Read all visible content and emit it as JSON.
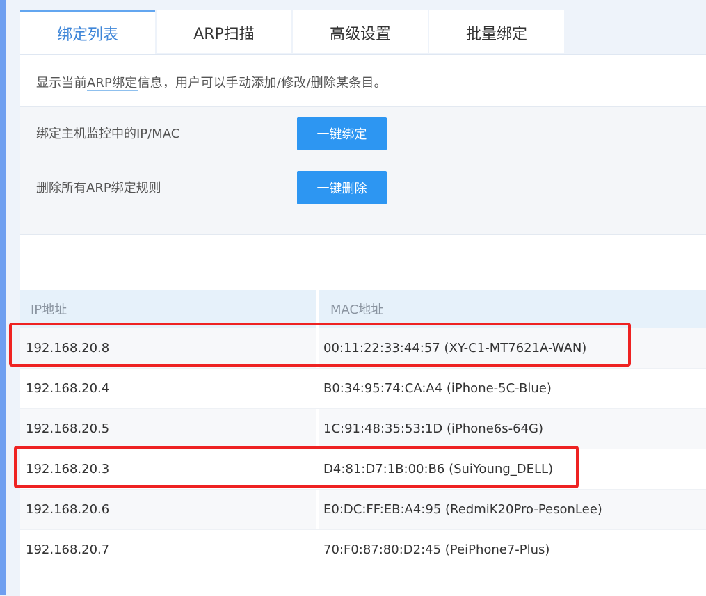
{
  "tabs": [
    "绑定列表",
    "ARP扫描",
    "高级设置",
    "批量绑定"
  ],
  "description": {
    "prefix": "显示当前",
    "highlight": "ARP绑定",
    "suffix": "信息，用户可以手动添加/修改/删除某条目。"
  },
  "actions": [
    {
      "label": "绑定主机监控中的IP/MAC",
      "button": "一键绑定"
    },
    {
      "label": "删除所有ARP绑定规则",
      "button": "一键删除"
    }
  ],
  "table": {
    "headers": {
      "ip": "IP地址",
      "mac": "MAC地址"
    },
    "rows": [
      {
        "ip": "192.168.20.8",
        "mac": "00:11:22:33:44:57 (XY-C1-MT7621A-WAN)"
      },
      {
        "ip": "192.168.20.4",
        "mac": "B0:34:95:74:CA:A4 (iPhone-5C-Blue)"
      },
      {
        "ip": "192.168.20.5",
        "mac": "1C:91:48:35:53:1D (iPhone6s-64G)"
      },
      {
        "ip": "192.168.20.3",
        "mac": "D4:81:D7:1B:00:B6 (SuiYoung_DELL)"
      },
      {
        "ip": "192.168.20.6",
        "mac": "E0:DC:FF:EB:A4:95 (RedmiK20Pro-PesonLee)"
      },
      {
        "ip": "192.168.20.7",
        "mac": "70:F0:87:80:D2:45 (PeiPhone7-Plus)"
      }
    ]
  },
  "colors": {
    "accent": "#2d96f2",
    "active_tab_text": "#3f86d8",
    "highlight_box": "#ee2222"
  }
}
